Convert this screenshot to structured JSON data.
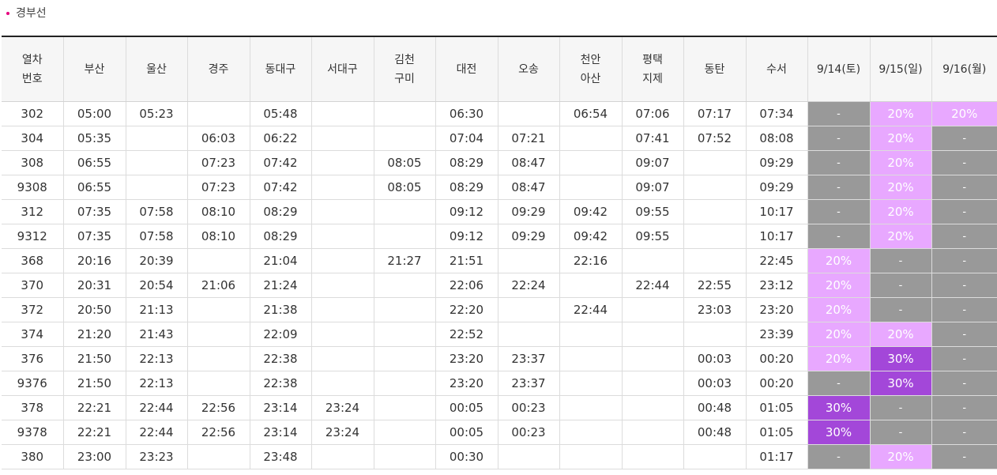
{
  "title": "경부선",
  "colors": {
    "accent_dot": "#e6007e",
    "none": "#999999",
    "discount_20": "#e8a8ff",
    "discount_30": "#a347d9"
  },
  "headers": [
    "열차\n번호",
    "부산",
    "울산",
    "경주",
    "동대구",
    "서대구",
    "김천\n구미",
    "대전",
    "오송",
    "천안\n아산",
    "평택\n지제",
    "동탄",
    "수서",
    "9/14(토)",
    "9/15(일)",
    "9/16(월)"
  ],
  "rows": [
    [
      "302",
      "05:00",
      "05:23",
      "",
      "05:48",
      "",
      "",
      "06:30",
      "",
      "06:54",
      "07:06",
      "07:17",
      "07:34",
      "-",
      "20%",
      "20%"
    ],
    [
      "304",
      "05:35",
      "",
      "06:03",
      "06:22",
      "",
      "",
      "07:04",
      "07:21",
      "",
      "07:41",
      "07:52",
      "08:08",
      "-",
      "20%",
      "-"
    ],
    [
      "308",
      "06:55",
      "",
      "07:23",
      "07:42",
      "",
      "08:05",
      "08:29",
      "08:47",
      "",
      "09:07",
      "",
      "09:29",
      "-",
      "20%",
      "-"
    ],
    [
      "9308",
      "06:55",
      "",
      "07:23",
      "07:42",
      "",
      "08:05",
      "08:29",
      "08:47",
      "",
      "09:07",
      "",
      "09:29",
      "-",
      "20%",
      "-"
    ],
    [
      "312",
      "07:35",
      "07:58",
      "08:10",
      "08:29",
      "",
      "",
      "09:12",
      "09:29",
      "09:42",
      "09:55",
      "",
      "10:17",
      "-",
      "20%",
      "-"
    ],
    [
      "9312",
      "07:35",
      "07:58",
      "08:10",
      "08:29",
      "",
      "",
      "09:12",
      "09:29",
      "09:42",
      "09:55",
      "",
      "10:17",
      "-",
      "20%",
      "-"
    ],
    [
      "368",
      "20:16",
      "20:39",
      "",
      "21:04",
      "",
      "21:27",
      "21:51",
      "",
      "22:16",
      "",
      "",
      "22:45",
      "20%",
      "-",
      "-"
    ],
    [
      "370",
      "20:31",
      "20:54",
      "21:06",
      "21:24",
      "",
      "",
      "22:06",
      "22:24",
      "",
      "22:44",
      "22:55",
      "23:12",
      "20%",
      "-",
      "-"
    ],
    [
      "372",
      "20:50",
      "21:13",
      "",
      "21:38",
      "",
      "",
      "22:20",
      "",
      "22:44",
      "",
      "23:03",
      "23:20",
      "20%",
      "-",
      "-"
    ],
    [
      "374",
      "21:20",
      "21:43",
      "",
      "22:09",
      "",
      "",
      "22:52",
      "",
      "",
      "",
      "",
      "23:39",
      "20%",
      "20%",
      "-"
    ],
    [
      "376",
      "21:50",
      "22:13",
      "",
      "22:38",
      "",
      "",
      "23:20",
      "23:37",
      "",
      "",
      "00:03",
      "00:20",
      "20%",
      "30%",
      "-"
    ],
    [
      "9376",
      "21:50",
      "22:13",
      "",
      "22:38",
      "",
      "",
      "23:20",
      "23:37",
      "",
      "",
      "00:03",
      "00:20",
      "-",
      "30%",
      "-"
    ],
    [
      "378",
      "22:21",
      "22:44",
      "22:56",
      "23:14",
      "23:24",
      "",
      "00:05",
      "00:23",
      "",
      "",
      "00:48",
      "01:05",
      "30%",
      "-",
      "-"
    ],
    [
      "9378",
      "22:21",
      "22:44",
      "22:56",
      "23:14",
      "23:24",
      "",
      "00:05",
      "00:23",
      "",
      "",
      "00:48",
      "01:05",
      "30%",
      "-",
      "-"
    ],
    [
      "380",
      "23:00",
      "23:23",
      "",
      "23:48",
      "",
      "",
      "00:30",
      "",
      "",
      "",
      "",
      "01:17",
      "-",
      "20%",
      "-"
    ]
  ]
}
